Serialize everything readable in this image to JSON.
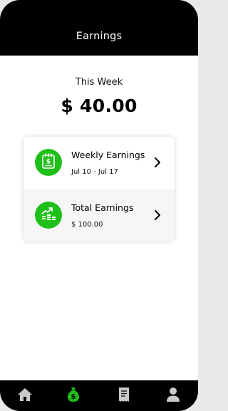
{
  "header": {
    "title": "Earnings"
  },
  "summary": {
    "label": "This Week",
    "amount": "$ 40.00"
  },
  "cards": [
    {
      "title": "Weekly Earnings",
      "subtitle": "Jul 10 - Jul 17",
      "icon": "calendar-dollar-icon"
    },
    {
      "title": "Total Earnings",
      "subtitle": "$ 100.00",
      "icon": "growth-chart-icon"
    }
  ],
  "nav": [
    {
      "name": "home",
      "icon": "home-icon",
      "active": false
    },
    {
      "name": "earnings",
      "icon": "money-bag-icon",
      "active": true
    },
    {
      "name": "history",
      "icon": "receipt-icon",
      "active": false
    },
    {
      "name": "profile",
      "icon": "user-icon",
      "active": false
    }
  ],
  "colors": {
    "accent": "#1fbf1a",
    "header": "#000000",
    "nav_inactive": "#c9c9c9"
  }
}
